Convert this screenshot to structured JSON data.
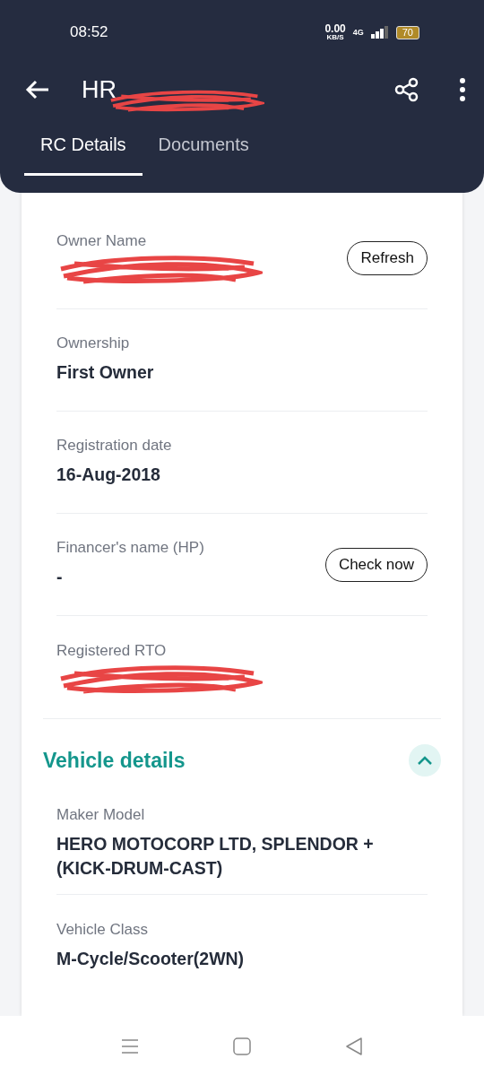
{
  "status_bar": {
    "time": "08:52",
    "net_speed": "0.00",
    "net_unit": "KB/S",
    "network": "4G",
    "battery": "70"
  },
  "app_bar": {
    "title": "HR",
    "title_redacted": true
  },
  "tabs": [
    {
      "label": "RC Details",
      "selected": true
    },
    {
      "label": "Documents",
      "selected": false
    }
  ],
  "fields": [
    {
      "kind": "action",
      "label": "Owner Name",
      "redacted": true,
      "button": "Refresh"
    },
    {
      "kind": "text",
      "label": "Ownership",
      "value": "First Owner"
    },
    {
      "kind": "text",
      "label": "Registration date",
      "value": "16-Aug-2018"
    },
    {
      "kind": "action",
      "label": "Financer's name (HP)",
      "value": "-",
      "button": "Check now"
    },
    {
      "kind": "text",
      "label": "Registered RTO",
      "redacted": true
    }
  ],
  "vehicle_section": {
    "title": "Vehicle details",
    "expanded": true,
    "fields": [
      {
        "kind": "text",
        "label": "Maker Model",
        "value": "HERO MOTOCORP LTD, SPLENDOR + (KICK-DRUM-CAST)"
      },
      {
        "kind": "text",
        "label": "Vehicle Class",
        "value": "M-Cycle/Scooter(2WN)"
      }
    ]
  }
}
